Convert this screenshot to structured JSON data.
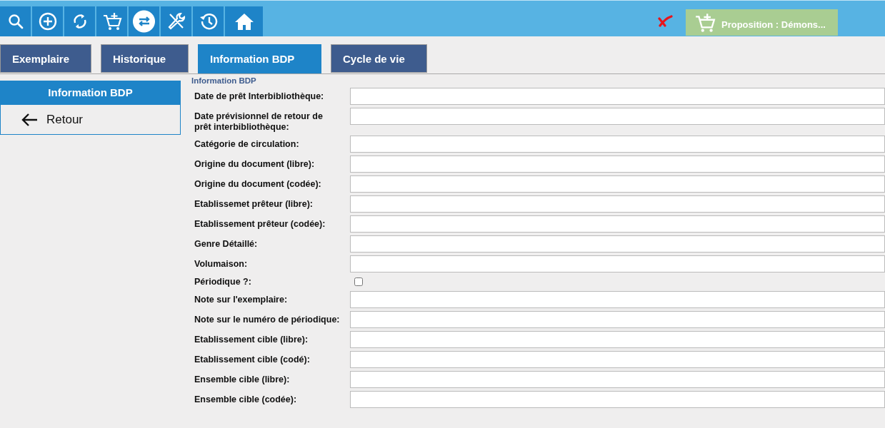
{
  "toolbar": {
    "buttons": [
      {
        "kind": "search",
        "selected": false
      },
      {
        "kind": "add",
        "selected": false
      },
      {
        "kind": "refresh",
        "selected": false
      },
      {
        "kind": "cart",
        "selected": false
      },
      {
        "kind": "swap",
        "selected": true
      },
      {
        "kind": "tools",
        "selected": false
      },
      {
        "kind": "history",
        "selected": false
      },
      {
        "kind": "home",
        "selected": false
      }
    ],
    "proposition": "Proposition : Démons..."
  },
  "tabs": [
    {
      "label": "Exemplaire",
      "selected": false
    },
    {
      "label": "Historique",
      "selected": false
    },
    {
      "label": "Information BDP",
      "selected": true
    },
    {
      "label": "Cycle de vie",
      "selected": false
    }
  ],
  "sidebar": {
    "title": "Information BDP",
    "back": "Retour"
  },
  "form": {
    "title": "Information BDP",
    "fields": [
      {
        "label": "Date de prêt Interbibliothèque:",
        "kind": "text"
      },
      {
        "label": "Date prévisionnel de retour de prêt interbibliothèque:",
        "kind": "text"
      },
      {
        "label": "Catégorie de circulation:",
        "kind": "text"
      },
      {
        "label": "Origine du document (libre):",
        "kind": "text"
      },
      {
        "label": "Origine du document (codée):",
        "kind": "text"
      },
      {
        "label": "Etablissemet prêteur (libre):",
        "kind": "text"
      },
      {
        "label": "Etablissement prêteur (codée):",
        "kind": "text"
      },
      {
        "label": "Genre Détaillé:",
        "kind": "text"
      },
      {
        "label": "Volumaison:",
        "kind": "text"
      },
      {
        "label": "Périodique ?:",
        "kind": "checkbox",
        "checked": false
      },
      {
        "label": "Note sur l'exemplaire:",
        "kind": "text"
      },
      {
        "label": "Note sur le numéro de périodique:",
        "kind": "text"
      },
      {
        "label": "Etablissement cible (libre):",
        "kind": "text"
      },
      {
        "label": "Etablissement cible (codé):",
        "kind": "text"
      },
      {
        "label": "Ensemble cible (libre):",
        "kind": "text"
      },
      {
        "label": "Ensemble cible (codée):",
        "kind": "text"
      }
    ]
  }
}
